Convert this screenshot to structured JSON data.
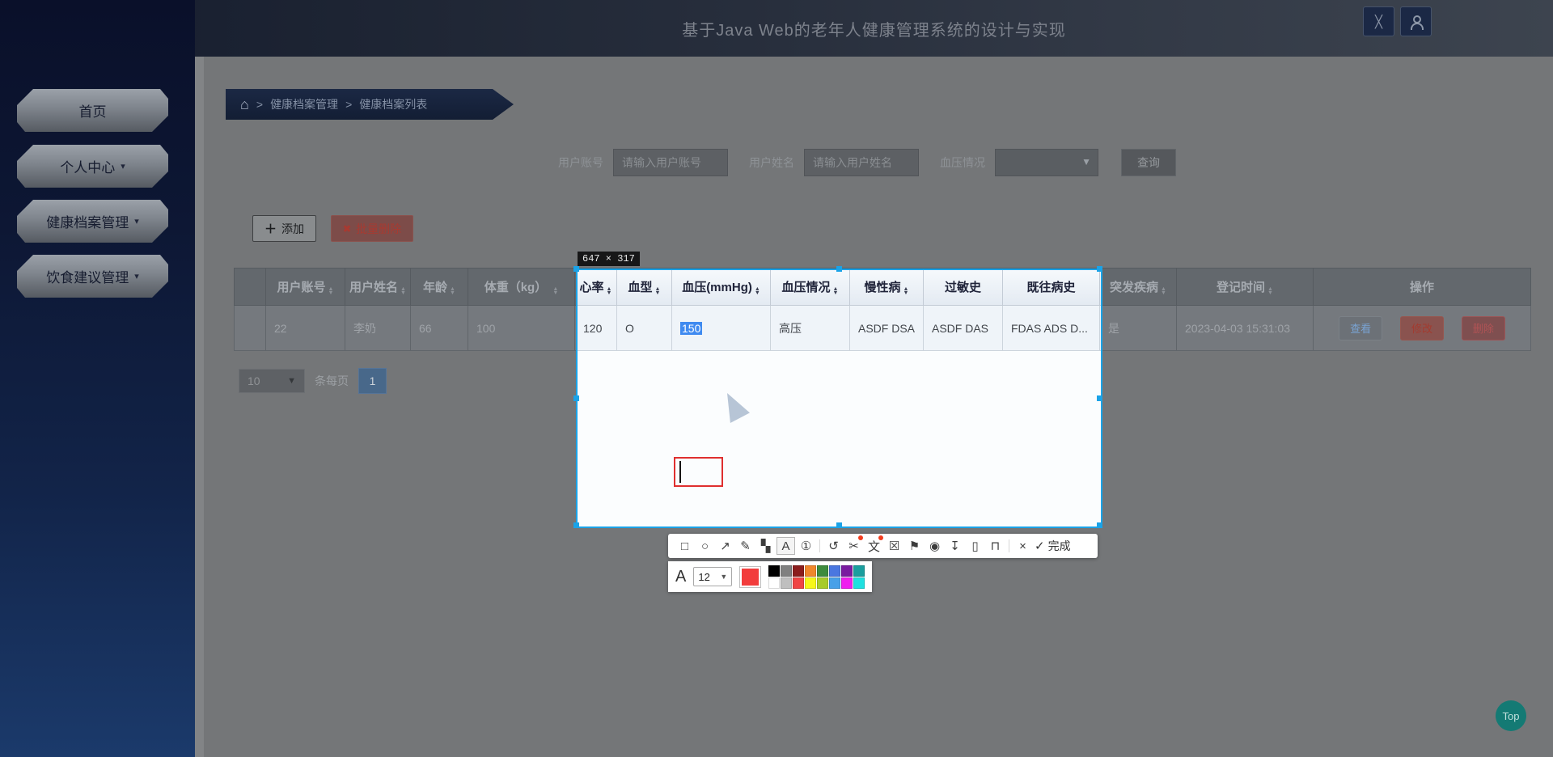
{
  "header": {
    "title": "基于Java Web的老年人健康管理系统的设计与实现",
    "icons": [
      {
        "name": "fullscreen-icon",
        "glyph": "╳"
      },
      {
        "name": "user-icon",
        "glyph": "user-silhouette"
      }
    ]
  },
  "sidebar": {
    "items": [
      {
        "label": "首页",
        "dropdown": false
      },
      {
        "label": "个人中心",
        "dropdown": true
      },
      {
        "label": "健康档案管理",
        "dropdown": true
      },
      {
        "label": "饮食建议管理",
        "dropdown": true
      }
    ]
  },
  "breadcrumb": {
    "home_icon": "⌂",
    "separator": ">",
    "items": [
      "健康档案管理",
      "健康档案列表"
    ]
  },
  "search": {
    "account_label": "用户账号",
    "account_placeholder": "请输入用户账号",
    "name_label": "用户姓名",
    "name_placeholder": "请输入用户姓名",
    "bp_label": "血压情况",
    "bp_selected_value": "",
    "submit_label": "查询"
  },
  "actions": {
    "add_label": "添加",
    "batch_delete_label": "批量删除"
  },
  "table": {
    "columns": [
      {
        "label": "",
        "sortable": false
      },
      {
        "label": "用户账号",
        "sortable": true
      },
      {
        "label": "用户姓名",
        "sortable": true
      },
      {
        "label": "年龄",
        "sortable": true
      },
      {
        "label": "体重（kg）",
        "sortable": true
      },
      {
        "label": "心率",
        "sortable": true
      },
      {
        "label": "血型",
        "sortable": true
      },
      {
        "label": "血压(mmHg)",
        "sortable": true
      },
      {
        "label": "血压情况",
        "sortable": true
      },
      {
        "label": "慢性病",
        "sortable": true
      },
      {
        "label": "过敏史",
        "sortable": false
      },
      {
        "label": "既往病史",
        "sortable": false
      },
      {
        "label": "突发疾病",
        "sortable": true
      },
      {
        "label": "登记时间",
        "sortable": true
      },
      {
        "label": "操作",
        "sortable": false
      }
    ],
    "row": {
      "account": "22",
      "name": "李奶",
      "age": "66",
      "weight": "100",
      "heart_rate": "120",
      "blood_type": "O",
      "blood_pressure": "150",
      "bp_status": "高压",
      "chronic": "ASDF DSA",
      "allergy": "ASDF DAS",
      "history": "FDAS ADS D...",
      "sudden": "是",
      "reg_time": "2023-04-03 15:31:03"
    },
    "row_actions": [
      "查看",
      "修改",
      "删除"
    ]
  },
  "pagination": {
    "page_size": "10",
    "unit_label": "条每页",
    "current_page": "1"
  },
  "back_to_top_label": "Top",
  "snip_tool": {
    "selection_size_label": "647 × 317",
    "toolbar_icons": [
      {
        "name": "rect-tool-icon",
        "glyph": "□"
      },
      {
        "name": "ellipse-tool-icon",
        "glyph": "○"
      },
      {
        "name": "arrow-tool-icon",
        "glyph": "↗"
      },
      {
        "name": "pen-tool-icon",
        "glyph": "✎"
      },
      {
        "name": "mosaic-tool-icon",
        "glyph": "▚"
      },
      {
        "name": "text-tool-icon",
        "glyph": "A"
      },
      {
        "name": "step-number-tool-icon",
        "glyph": "①"
      },
      {
        "name": "undo-icon",
        "glyph": "↺"
      },
      {
        "name": "cut-icon",
        "glyph": "✂"
      },
      {
        "name": "ocr-text-icon",
        "glyph": "文"
      },
      {
        "name": "fit-screen-icon",
        "glyph": "☒"
      },
      {
        "name": "pin-icon",
        "glyph": "⚑"
      },
      {
        "name": "record-icon",
        "glyph": "◉"
      },
      {
        "name": "save-icon",
        "glyph": "↧"
      },
      {
        "name": "device-icon",
        "glyph": "▯"
      },
      {
        "name": "bookmark-icon",
        "glyph": "⊓"
      },
      {
        "name": "cancel-icon",
        "glyph": "×"
      }
    ],
    "done_check_glyph": "✓",
    "done_label": "完成",
    "text_options": {
      "font_size": "12",
      "current_color": "#f23c3c",
      "palette": [
        "#000000",
        "#808080",
        "#8b1d1d",
        "#f0872c",
        "#3d8b3d",
        "#4a77e0",
        "#7a1ba0",
        "#1a9e9e",
        "#ffffff",
        "#bfbfbf",
        "#ef4444",
        "#f7f719",
        "#a7cb2b",
        "#47a0e8",
        "#ef1fef",
        "#1fe0e0"
      ]
    }
  }
}
